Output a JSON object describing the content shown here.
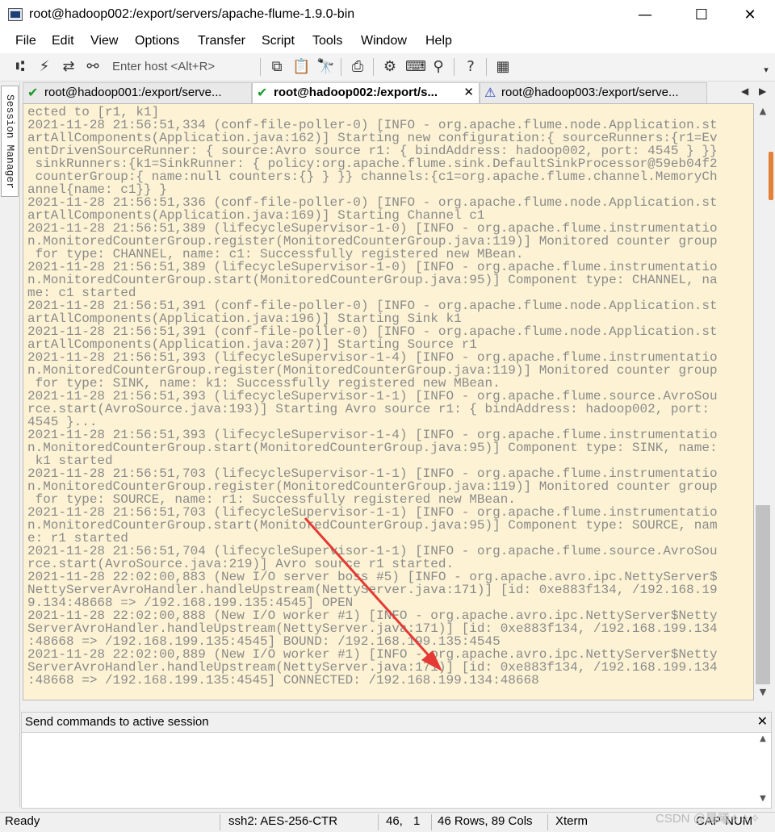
{
  "window": {
    "title": "root@hadoop002:/export/servers/apache-flume-1.9.0-bin",
    "minimize": "—",
    "maximize": "☐",
    "close": "✕"
  },
  "menu": [
    "File",
    "Edit",
    "View",
    "Options",
    "Transfer",
    "Script",
    "Tools",
    "Window",
    "Help"
  ],
  "toolbar": {
    "enter_host_placeholder": "Enter host <Alt+R>",
    "icons": [
      "connect-icon",
      "quick-connect-icon",
      "reconnect-icon",
      "disconnect-icon",
      "copy-icon",
      "paste-icon",
      "find-icon",
      "print-icon",
      "settings-icon",
      "keymap-icon",
      "sftp-icon",
      "help-icon",
      "screenshot-icon"
    ],
    "overflow": "▾"
  },
  "sidebar": {
    "session_manager_label": "Session Manager"
  },
  "tabs": [
    {
      "label": "root@hadoop001:/export/serve...",
      "status": "connected",
      "icon": "✔",
      "active": false
    },
    {
      "label": "root@hadoop002:/export/s...",
      "status": "connected",
      "icon": "✔",
      "active": true,
      "close": "✕"
    },
    {
      "label": "root@hadoop003:/export/serve...",
      "status": "warning",
      "icon": "⚠",
      "active": false
    }
  ],
  "tab_nav": {
    "prev": "◀",
    "next": "▶"
  },
  "terminal": {
    "lines": [
      "ected to [r1, k1]",
      "2021-11-28 21:56:51,334 (conf-file-poller-0) [INFO - org.apache.flume.node.Application.st",
      "artAllComponents(Application.java:162)] Starting new configuration:{ sourceRunners:{r1=Ev",
      "entDrivenSourceRunner: { source:Avro source r1: { bindAddress: hadoop002, port: 4545 } }}",
      " sinkRunners:{k1=SinkRunner: { policy:org.apache.flume.sink.DefaultSinkProcessor@59eb04f2",
      " counterGroup:{ name:null counters:{} } }} channels:{c1=org.apache.flume.channel.MemoryCh",
      "annel{name: c1}} }",
      "2021-11-28 21:56:51,336 (conf-file-poller-0) [INFO - org.apache.flume.node.Application.st",
      "artAllComponents(Application.java:169)] Starting Channel c1",
      "2021-11-28 21:56:51,389 (lifecycleSupervisor-1-0) [INFO - org.apache.flume.instrumentatio",
      "n.MonitoredCounterGroup.register(MonitoredCounterGroup.java:119)] Monitored counter group",
      " for type: CHANNEL, name: c1: Successfully registered new MBean.",
      "2021-11-28 21:56:51,389 (lifecycleSupervisor-1-0) [INFO - org.apache.flume.instrumentatio",
      "n.MonitoredCounterGroup.start(MonitoredCounterGroup.java:95)] Component type: CHANNEL, na",
      "me: c1 started",
      "2021-11-28 21:56:51,391 (conf-file-poller-0) [INFO - org.apache.flume.node.Application.st",
      "artAllComponents(Application.java:196)] Starting Sink k1",
      "2021-11-28 21:56:51,391 (conf-file-poller-0) [INFO - org.apache.flume.node.Application.st",
      "artAllComponents(Application.java:207)] Starting Source r1",
      "2021-11-28 21:56:51,393 (lifecycleSupervisor-1-4) [INFO - org.apache.flume.instrumentatio",
      "n.MonitoredCounterGroup.register(MonitoredCounterGroup.java:119)] Monitored counter group",
      " for type: SINK, name: k1: Successfully registered new MBean.",
      "2021-11-28 21:56:51,393 (lifecycleSupervisor-1-1) [INFO - org.apache.flume.source.AvroSou",
      "rce.start(AvroSource.java:193)] Starting Avro source r1: { bindAddress: hadoop002, port:",
      "4545 }...",
      "2021-11-28 21:56:51,393 (lifecycleSupervisor-1-4) [INFO - org.apache.flume.instrumentatio",
      "n.MonitoredCounterGroup.start(MonitoredCounterGroup.java:95)] Component type: SINK, name:",
      " k1 started",
      "2021-11-28 21:56:51,703 (lifecycleSupervisor-1-1) [INFO - org.apache.flume.instrumentatio",
      "n.MonitoredCounterGroup.register(MonitoredCounterGroup.java:119)] Monitored counter group",
      " for type: SOURCE, name: r1: Successfully registered new MBean.",
      "2021-11-28 21:56:51,703 (lifecycleSupervisor-1-1) [INFO - org.apache.flume.instrumentatio",
      "n.MonitoredCounterGroup.start(MonitoredCounterGroup.java:95)] Component type: SOURCE, nam",
      "e: r1 started",
      "2021-11-28 21:56:51,704 (lifecycleSupervisor-1-1) [INFO - org.apache.flume.source.AvroSou",
      "rce.start(AvroSource.java:219)] Avro source r1 started.",
      "2021-11-28 22:02:00,883 (New I/O server boss #5) [INFO - org.apache.avro.ipc.NettyServer$",
      "NettyServerAvroHandler.handleUpstream(NettyServer.java:171)] [id: 0xe883f134, /192.168.19",
      "9.134:48668 => /192.168.199.135:4545] OPEN",
      "2021-11-28 22:02:00,888 (New I/O worker #1) [INFO - org.apache.avro.ipc.NettyServer$Netty",
      "ServerAvroHandler.handleUpstream(NettyServer.java:171)] [id: 0xe883f134, /192.168.199.134",
      ":48668 => /192.168.199.135:4545] BOUND: /192.168.199.135:4545",
      "2021-11-28 22:02:00,889 (New I/O worker #1) [INFO - org.apache.avro.ipc.NettyServer$Netty",
      "ServerAvroHandler.handleUpstream(NettyServer.java:171)] [id: 0xe883f134, /192.168.199.134",
      ":48668 => /192.168.199.135:4545] CONNECTED: /192.168.199.134:48668"
    ],
    "text_color": "#8a8a8a",
    "background": "#fdf3d4"
  },
  "command_window": {
    "label": "Send commands to active session",
    "close": "✕"
  },
  "status": {
    "ready": "Ready",
    "cipher": "ssh2: AES-256-CTR",
    "row": "46,",
    "col": "1",
    "size": "46 Rows, 89 Cols",
    "emulation": "Xterm",
    "caps": "CAP",
    "num": "NUM"
  },
  "watermark": "CSDN @晨曦✧✧✧",
  "annotation": {
    "arrow_color": "#e53935"
  }
}
